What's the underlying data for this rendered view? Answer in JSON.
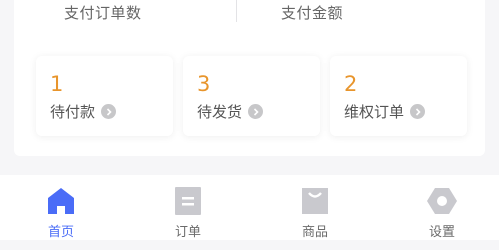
{
  "stats": {
    "order_count_label": "支付订单数",
    "amount_label": "支付金额"
  },
  "tiles": [
    {
      "count": "1",
      "label": "待付款"
    },
    {
      "count": "3",
      "label": "待发货"
    },
    {
      "count": "2",
      "label": "维权订单"
    }
  ],
  "tabbar": {
    "items": [
      {
        "label": "首页",
        "icon": "home-icon",
        "active": true
      },
      {
        "label": "订单",
        "icon": "order-icon",
        "active": false
      },
      {
        "label": "商品",
        "icon": "bag-icon",
        "active": false
      },
      {
        "label": "设置",
        "icon": "settings-icon",
        "active": false
      }
    ]
  },
  "colors": {
    "accent": "#4a6cf7",
    "count": "#e8952c",
    "inactive_icon": "#c9c9ce",
    "text": "#555555"
  }
}
